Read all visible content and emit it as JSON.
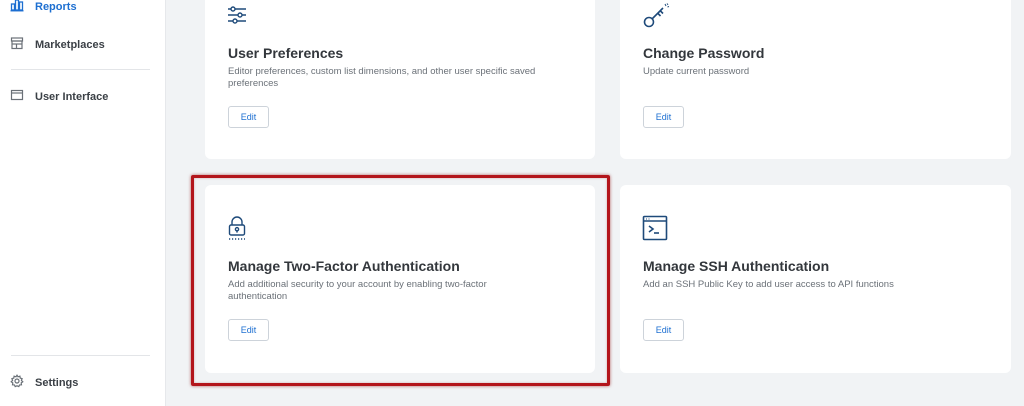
{
  "sidebar": {
    "items": [
      {
        "label": "Reports",
        "icon": "bar-chart-icon",
        "active": true
      },
      {
        "label": "Marketplaces",
        "icon": "storefront-icon"
      },
      {
        "label": "User Interface",
        "icon": "window-icon"
      },
      {
        "label": "Settings",
        "icon": "gear-icon"
      }
    ]
  },
  "cards": [
    {
      "title": "User Preferences",
      "description": "Editor preferences, custom list dimensions, and other user specific saved preferences",
      "button": "Edit",
      "icon": "sliders-icon"
    },
    {
      "title": "Change Password",
      "description": "Update current password",
      "button": "Edit",
      "icon": "key-icon"
    },
    {
      "title": "Manage Two-Factor Authentication",
      "description": "Add additional security to your account by enabling two-factor authentication",
      "button": "Edit",
      "icon": "lock-icon"
    },
    {
      "title": "Manage SSH Authentication",
      "description": "Add an SSH Public Key to add user access to API functions",
      "button": "Edit",
      "icon": "terminal-icon"
    }
  ],
  "colors": {
    "accent": "#1d6fd1",
    "icon": "#1e4a7a",
    "highlight": "#b3151b",
    "background": "#f1f3f5"
  }
}
